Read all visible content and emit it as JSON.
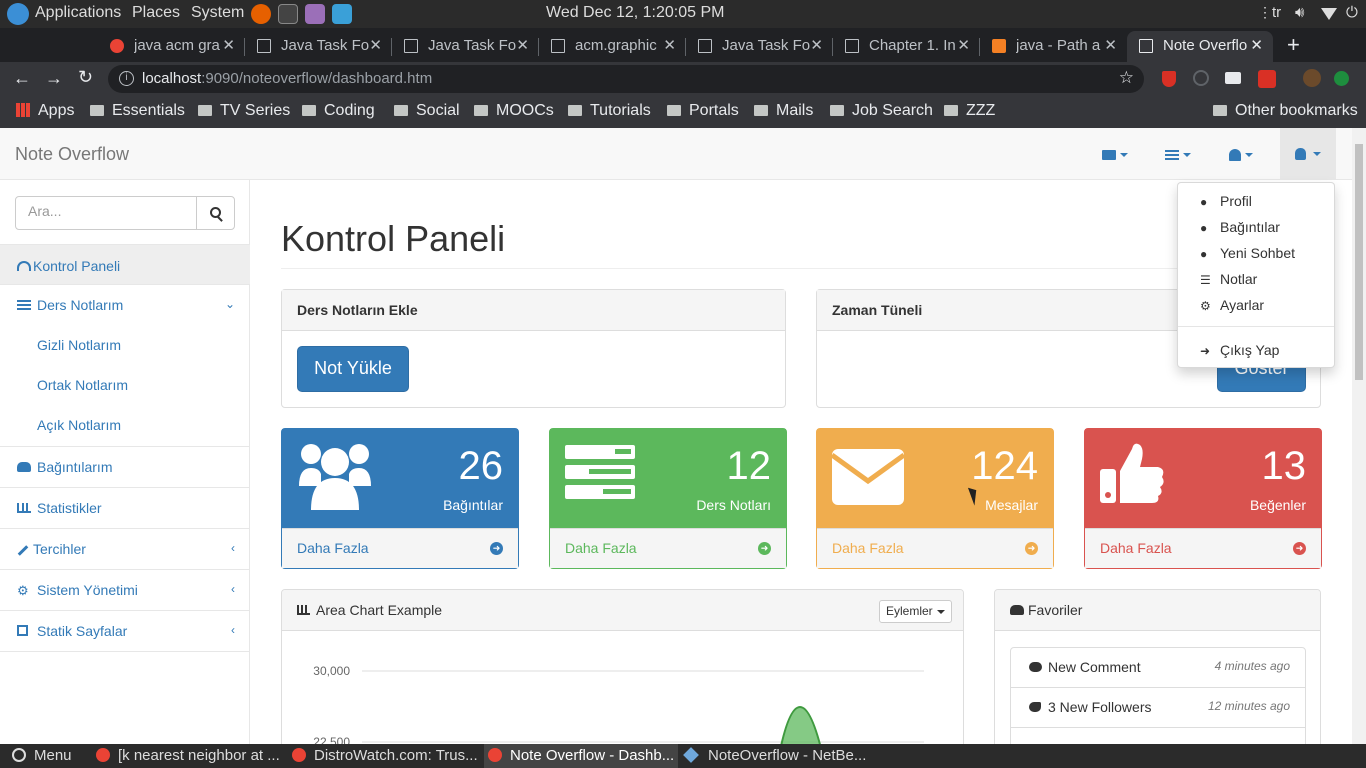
{
  "system_panel": {
    "menus": [
      "Applications",
      "Places",
      "System"
    ],
    "clock": "Wed Dec 12,  1:20:05 PM",
    "keyboard": "tr"
  },
  "browser": {
    "tabs": [
      {
        "title": "java acm gra"
      },
      {
        "title": "Java Task Fo"
      },
      {
        "title": "Java Task Fo"
      },
      {
        "title": "acm.graphic"
      },
      {
        "title": "Java Task Fo"
      },
      {
        "title": "Chapter 1. In"
      },
      {
        "title": "java - Path a"
      },
      {
        "title": "Note Overflo"
      }
    ],
    "new_tab": "+",
    "url_host": "localhost",
    "url_rest": ":9090/noteoverflow/dashboard.htm",
    "bookmarks": [
      "Apps",
      "Essentials",
      "TV Series",
      "Coding",
      "Social",
      "MOOCs",
      "Tutorials",
      "Portals",
      "Mails",
      "Job Search",
      "ZZZ"
    ],
    "other_bookmarks": "Other bookmarks"
  },
  "navbar": {
    "brand": "Note Overflow"
  },
  "sidebar": {
    "search_placeholder": "Ara...",
    "items": [
      {
        "label": "Kontrol Paneli"
      },
      {
        "label": "Ders Notlarım"
      },
      {
        "label": "Gizli Notlarım"
      },
      {
        "label": "Ortak Notlarım"
      },
      {
        "label": "Açık Notlarım"
      },
      {
        "label": "Bağıntılarım"
      },
      {
        "label": "Statistikler"
      },
      {
        "label": "Tercihler"
      },
      {
        "label": "Sistem Yönetimi"
      },
      {
        "label": "Statik Sayfalar"
      }
    ]
  },
  "main": {
    "page_title": "Kontrol Paneli",
    "upload_panel": {
      "title": "Ders Notların Ekle",
      "button": "Not Yükle"
    },
    "timeline_panel": {
      "title": "Zaman Tüneli",
      "button": "Göster"
    },
    "stats": [
      {
        "value": "26",
        "label": "Bağıntılar",
        "more": "Daha Fazla",
        "color": "#337ab7"
      },
      {
        "value": "12",
        "label": "Ders Notları",
        "more": "Daha Fazla",
        "color": "#5cb85c"
      },
      {
        "value": "124",
        "label": "Mesajlar",
        "more": "Daha Fazla",
        "color": "#f0ad4e"
      },
      {
        "value": "13",
        "label": "Beğenler",
        "more": "Daha Fazla",
        "color": "#d9534f"
      }
    ],
    "area_chart": {
      "title": "Area Chart Example",
      "actions": "Eylemler",
      "ticks": [
        "30,000",
        "22,500"
      ]
    },
    "favorites": {
      "title": "Favoriler",
      "items": [
        {
          "text": "New Comment",
          "time": "4 minutes ago"
        },
        {
          "text": "3 New Followers",
          "time": "12 minutes ago"
        }
      ]
    }
  },
  "user_menu": {
    "items": [
      "Profil",
      "Bağıntılar",
      "Yeni Sohbet",
      "Notlar",
      "Ayarlar"
    ],
    "logout": "Çıkış Yap"
  },
  "taskbar": {
    "menu": "Menu",
    "windows": [
      "[k nearest neighbor at ...",
      "DistroWatch.com: Trus...",
      "Note Overflow - Dashb...",
      "NoteOverflow - NetBe..."
    ]
  }
}
